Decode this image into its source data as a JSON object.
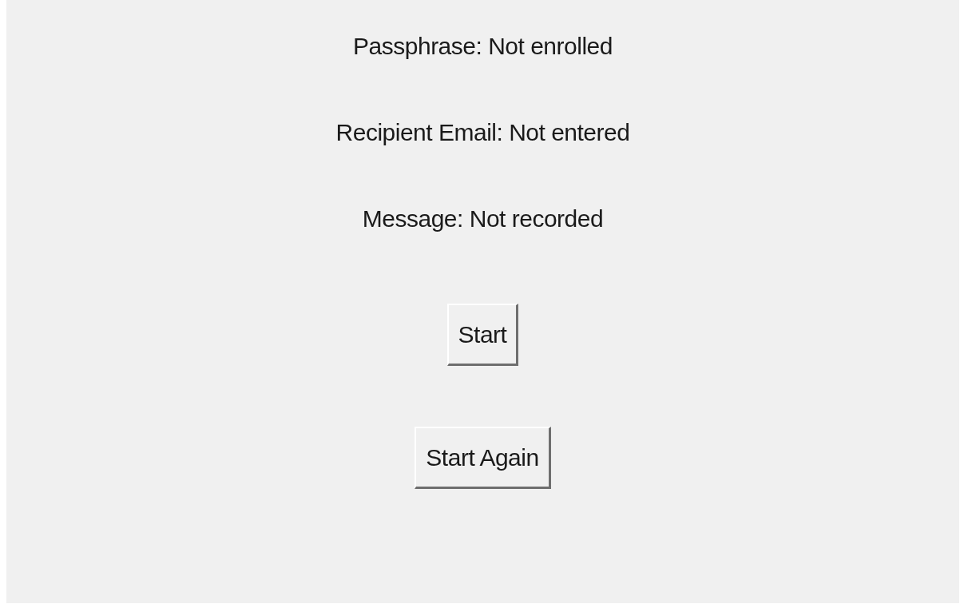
{
  "status_lines": [
    "Passphrase: Not enrolled",
    "Recipient Email: Not entered",
    "Message: Not recorded"
  ],
  "buttons": [
    "Start",
    "Start Again"
  ]
}
